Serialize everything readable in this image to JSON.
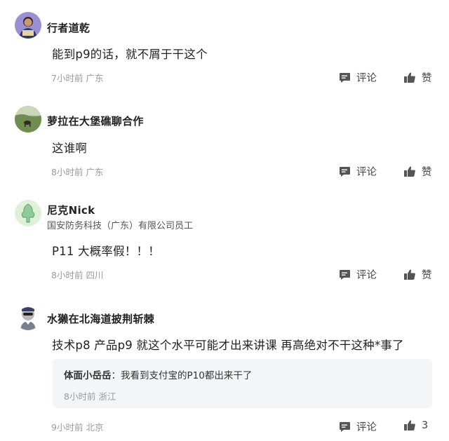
{
  "comments": [
    {
      "name": "行者道乾",
      "text": "能到p9的话，就不屑于干这个",
      "time": "7小时前",
      "location": "广东",
      "comment_label": "评论",
      "like_label": "赞"
    },
    {
      "name": "萝拉在大堡礁聊合作",
      "text": "这谁啊",
      "time": "8小时前",
      "location": "广东",
      "comment_label": "评论",
      "like_label": "赞"
    },
    {
      "name": "尼克Nick",
      "subtitle": "国安防务科技（广东）有限公司员工",
      "text": "P11 大概率假！！！",
      "time": "8小时前",
      "location": "四川",
      "comment_label": "评论",
      "like_label": "赞"
    },
    {
      "name": "水獭在北海道披荆斩棘",
      "text": "技术p8 产品p9 就这个水平可能才出来讲课 再高绝对不干这种*事了",
      "time": "9小时前",
      "location": "北京",
      "comment_label": "评论",
      "like_label": "3",
      "reply": {
        "name": "体面小岳岳",
        "separator": "：",
        "text": "我看到支付宝的P10都出来干了",
        "time": "8小时前",
        "location": "浙江"
      }
    }
  ],
  "icons": {
    "comment": "comment-bubble-icon",
    "like": "thumbs-up-icon"
  },
  "colors": {
    "text": "#222222",
    "meta": "#9a9a9a",
    "action": "#444444",
    "reply_bg": "#f4f5f9"
  }
}
